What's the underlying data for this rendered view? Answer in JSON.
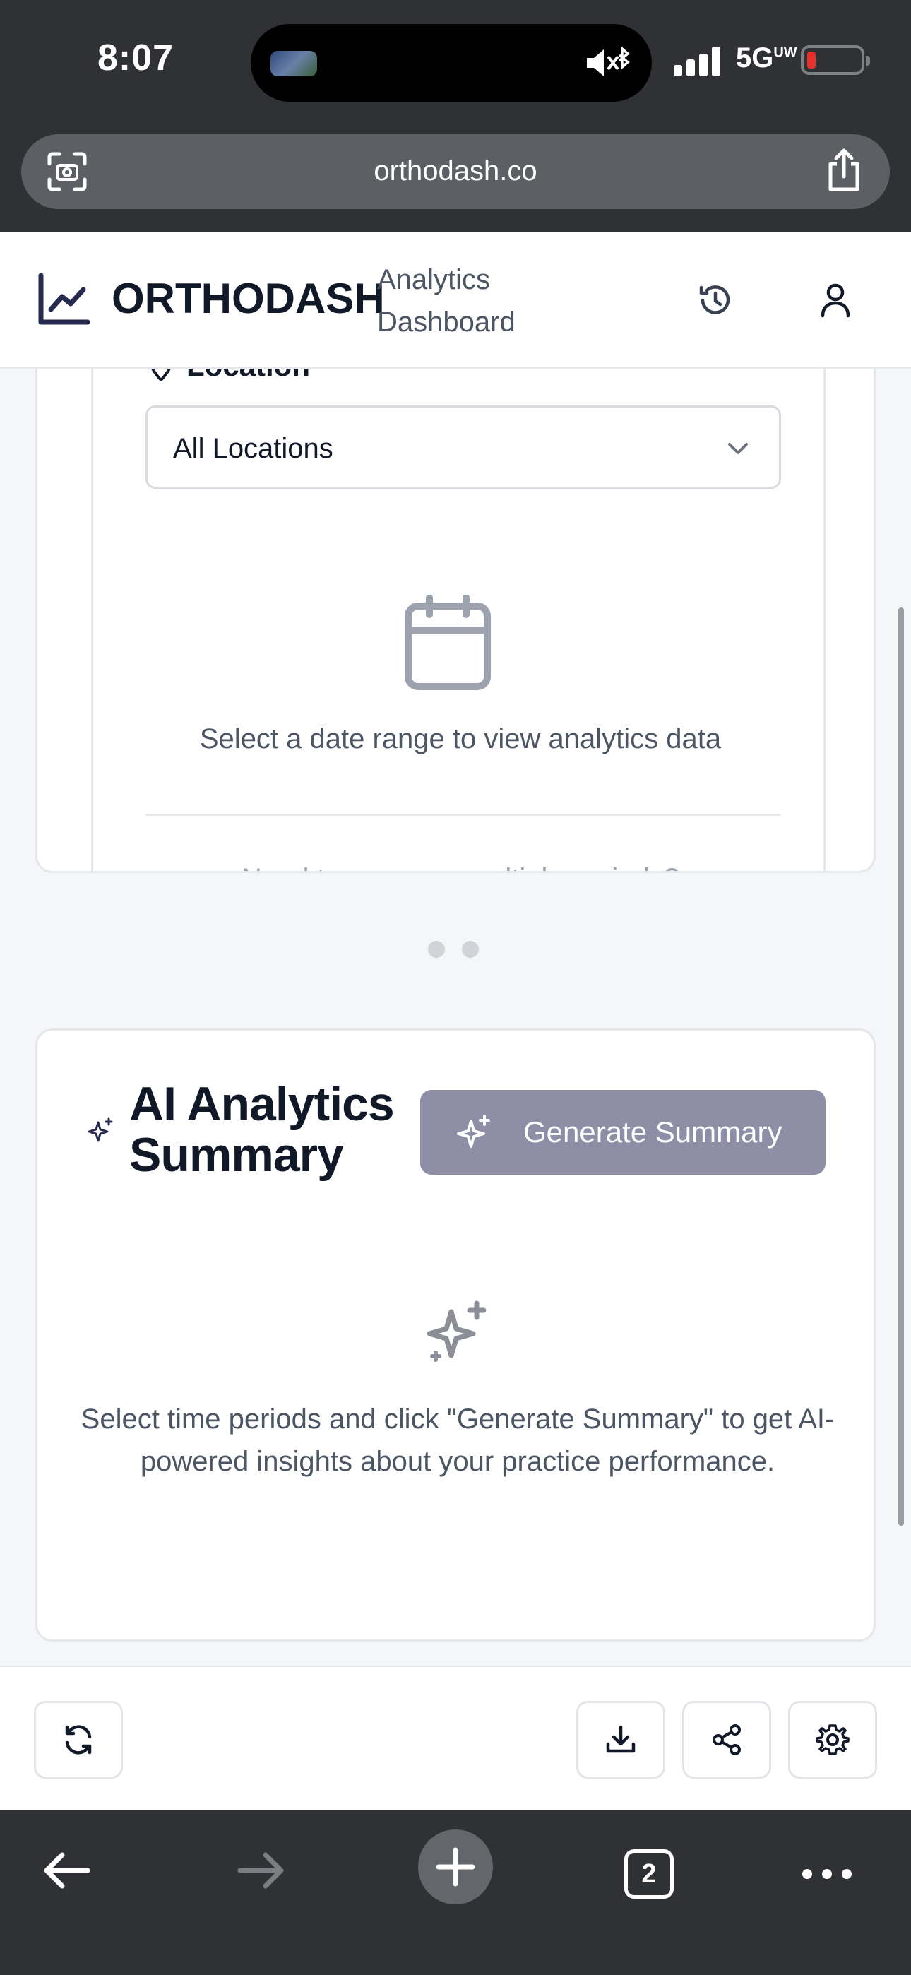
{
  "status_bar": {
    "time": "8:07",
    "network": "5G",
    "network_sup": "UW",
    "battery_color": "#e5302b"
  },
  "browser": {
    "url": "orthodash.co"
  },
  "header": {
    "brand": "ORTHODASH",
    "subtitle_line1": "Analytics",
    "subtitle_line2": "Dashboard"
  },
  "filters": {
    "location_label": "Location",
    "location_value": "All Locations",
    "empty_message": "Select a date range to view analytics data",
    "faded_text": "Need to compare multiple periods?"
  },
  "carousel": {
    "pages": 2,
    "active": 1
  },
  "ai_summary": {
    "title": "AI Analytics Summary",
    "button_label": "Generate Summary",
    "empty_message": "Select time periods and click \"Generate Summary\" to get AI-powered insights about your practice performance.",
    "accent": "#8e8ea6"
  },
  "toolbar": {
    "icons": [
      "refresh-icon",
      "download-icon",
      "share-icon",
      "settings-icon"
    ]
  },
  "safari_nav": {
    "tab_count": "2"
  }
}
